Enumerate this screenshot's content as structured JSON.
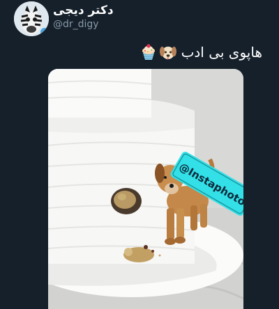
{
  "author": {
    "display_name": "دکتر دیجی",
    "handle": "@dr_digy"
  },
  "tweet": {
    "text": "هاپوی بی ادب"
  },
  "emojis": [
    "dog-face-emoji",
    "cupcake-emoji"
  ],
  "media": {
    "watermark_text": "@Instaphoto",
    "accent_color": "#33e0e8"
  }
}
